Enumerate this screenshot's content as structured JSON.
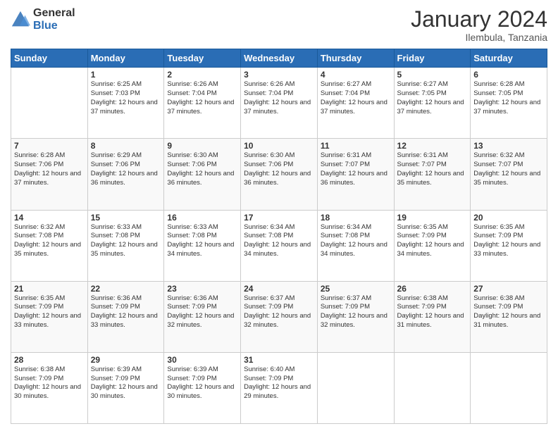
{
  "logo": {
    "general": "General",
    "blue": "Blue"
  },
  "title": "January 2024",
  "subtitle": "Ilembula, Tanzania",
  "days_header": [
    "Sunday",
    "Monday",
    "Tuesday",
    "Wednesday",
    "Thursday",
    "Friday",
    "Saturday"
  ],
  "weeks": [
    [
      {
        "day": "",
        "sunrise": "",
        "sunset": "",
        "daylight": ""
      },
      {
        "day": "1",
        "sunrise": "Sunrise: 6:25 AM",
        "sunset": "Sunset: 7:03 PM",
        "daylight": "Daylight: 12 hours and 37 minutes."
      },
      {
        "day": "2",
        "sunrise": "Sunrise: 6:26 AM",
        "sunset": "Sunset: 7:04 PM",
        "daylight": "Daylight: 12 hours and 37 minutes."
      },
      {
        "day": "3",
        "sunrise": "Sunrise: 6:26 AM",
        "sunset": "Sunset: 7:04 PM",
        "daylight": "Daylight: 12 hours and 37 minutes."
      },
      {
        "day": "4",
        "sunrise": "Sunrise: 6:27 AM",
        "sunset": "Sunset: 7:04 PM",
        "daylight": "Daylight: 12 hours and 37 minutes."
      },
      {
        "day": "5",
        "sunrise": "Sunrise: 6:27 AM",
        "sunset": "Sunset: 7:05 PM",
        "daylight": "Daylight: 12 hours and 37 minutes."
      },
      {
        "day": "6",
        "sunrise": "Sunrise: 6:28 AM",
        "sunset": "Sunset: 7:05 PM",
        "daylight": "Daylight: 12 hours and 37 minutes."
      }
    ],
    [
      {
        "day": "7",
        "sunrise": "Sunrise: 6:28 AM",
        "sunset": "Sunset: 7:06 PM",
        "daylight": "Daylight: 12 hours and 37 minutes."
      },
      {
        "day": "8",
        "sunrise": "Sunrise: 6:29 AM",
        "sunset": "Sunset: 7:06 PM",
        "daylight": "Daylight: 12 hours and 36 minutes."
      },
      {
        "day": "9",
        "sunrise": "Sunrise: 6:30 AM",
        "sunset": "Sunset: 7:06 PM",
        "daylight": "Daylight: 12 hours and 36 minutes."
      },
      {
        "day": "10",
        "sunrise": "Sunrise: 6:30 AM",
        "sunset": "Sunset: 7:06 PM",
        "daylight": "Daylight: 12 hours and 36 minutes."
      },
      {
        "day": "11",
        "sunrise": "Sunrise: 6:31 AM",
        "sunset": "Sunset: 7:07 PM",
        "daylight": "Daylight: 12 hours and 36 minutes."
      },
      {
        "day": "12",
        "sunrise": "Sunrise: 6:31 AM",
        "sunset": "Sunset: 7:07 PM",
        "daylight": "Daylight: 12 hours and 35 minutes."
      },
      {
        "day": "13",
        "sunrise": "Sunrise: 6:32 AM",
        "sunset": "Sunset: 7:07 PM",
        "daylight": "Daylight: 12 hours and 35 minutes."
      }
    ],
    [
      {
        "day": "14",
        "sunrise": "Sunrise: 6:32 AM",
        "sunset": "Sunset: 7:08 PM",
        "daylight": "Daylight: 12 hours and 35 minutes."
      },
      {
        "day": "15",
        "sunrise": "Sunrise: 6:33 AM",
        "sunset": "Sunset: 7:08 PM",
        "daylight": "Daylight: 12 hours and 35 minutes."
      },
      {
        "day": "16",
        "sunrise": "Sunrise: 6:33 AM",
        "sunset": "Sunset: 7:08 PM",
        "daylight": "Daylight: 12 hours and 34 minutes."
      },
      {
        "day": "17",
        "sunrise": "Sunrise: 6:34 AM",
        "sunset": "Sunset: 7:08 PM",
        "daylight": "Daylight: 12 hours and 34 minutes."
      },
      {
        "day": "18",
        "sunrise": "Sunrise: 6:34 AM",
        "sunset": "Sunset: 7:08 PM",
        "daylight": "Daylight: 12 hours and 34 minutes."
      },
      {
        "day": "19",
        "sunrise": "Sunrise: 6:35 AM",
        "sunset": "Sunset: 7:09 PM",
        "daylight": "Daylight: 12 hours and 34 minutes."
      },
      {
        "day": "20",
        "sunrise": "Sunrise: 6:35 AM",
        "sunset": "Sunset: 7:09 PM",
        "daylight": "Daylight: 12 hours and 33 minutes."
      }
    ],
    [
      {
        "day": "21",
        "sunrise": "Sunrise: 6:35 AM",
        "sunset": "Sunset: 7:09 PM",
        "daylight": "Daylight: 12 hours and 33 minutes."
      },
      {
        "day": "22",
        "sunrise": "Sunrise: 6:36 AM",
        "sunset": "Sunset: 7:09 PM",
        "daylight": "Daylight: 12 hours and 33 minutes."
      },
      {
        "day": "23",
        "sunrise": "Sunrise: 6:36 AM",
        "sunset": "Sunset: 7:09 PM",
        "daylight": "Daylight: 12 hours and 32 minutes."
      },
      {
        "day": "24",
        "sunrise": "Sunrise: 6:37 AM",
        "sunset": "Sunset: 7:09 PM",
        "daylight": "Daylight: 12 hours and 32 minutes."
      },
      {
        "day": "25",
        "sunrise": "Sunrise: 6:37 AM",
        "sunset": "Sunset: 7:09 PM",
        "daylight": "Daylight: 12 hours and 32 minutes."
      },
      {
        "day": "26",
        "sunrise": "Sunrise: 6:38 AM",
        "sunset": "Sunset: 7:09 PM",
        "daylight": "Daylight: 12 hours and 31 minutes."
      },
      {
        "day": "27",
        "sunrise": "Sunrise: 6:38 AM",
        "sunset": "Sunset: 7:09 PM",
        "daylight": "Daylight: 12 hours and 31 minutes."
      }
    ],
    [
      {
        "day": "28",
        "sunrise": "Sunrise: 6:38 AM",
        "sunset": "Sunset: 7:09 PM",
        "daylight": "Daylight: 12 hours and 30 minutes."
      },
      {
        "day": "29",
        "sunrise": "Sunrise: 6:39 AM",
        "sunset": "Sunset: 7:09 PM",
        "daylight": "Daylight: 12 hours and 30 minutes."
      },
      {
        "day": "30",
        "sunrise": "Sunrise: 6:39 AM",
        "sunset": "Sunset: 7:09 PM",
        "daylight": "Daylight: 12 hours and 30 minutes."
      },
      {
        "day": "31",
        "sunrise": "Sunrise: 6:40 AM",
        "sunset": "Sunset: 7:09 PM",
        "daylight": "Daylight: 12 hours and 29 minutes."
      },
      {
        "day": "",
        "sunrise": "",
        "sunset": "",
        "daylight": ""
      },
      {
        "day": "",
        "sunrise": "",
        "sunset": "",
        "daylight": ""
      },
      {
        "day": "",
        "sunrise": "",
        "sunset": "",
        "daylight": ""
      }
    ]
  ]
}
